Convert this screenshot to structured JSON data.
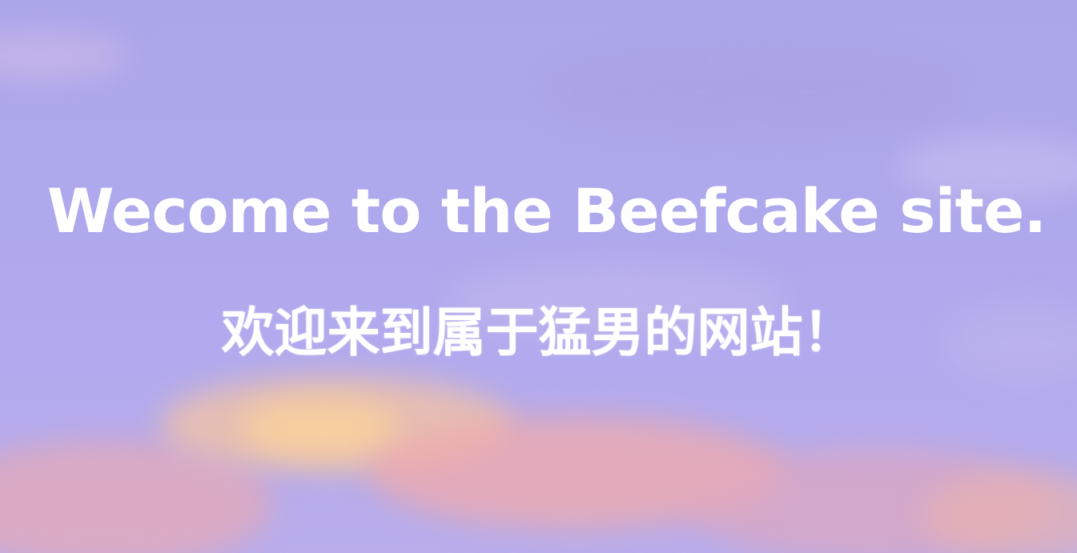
{
  "hero": {
    "title_en": "Wecome to the Beefcake site.",
    "title_zh": "欢迎来到属于猛男的网站！",
    "background": "pastel purple sky with pink-orange clouds",
    "colors": {
      "sky": "#aea8ec",
      "cloud_pink": "#f0aaaa",
      "cloud_orange": "#f6c4a0",
      "text": "#ffffff"
    }
  }
}
